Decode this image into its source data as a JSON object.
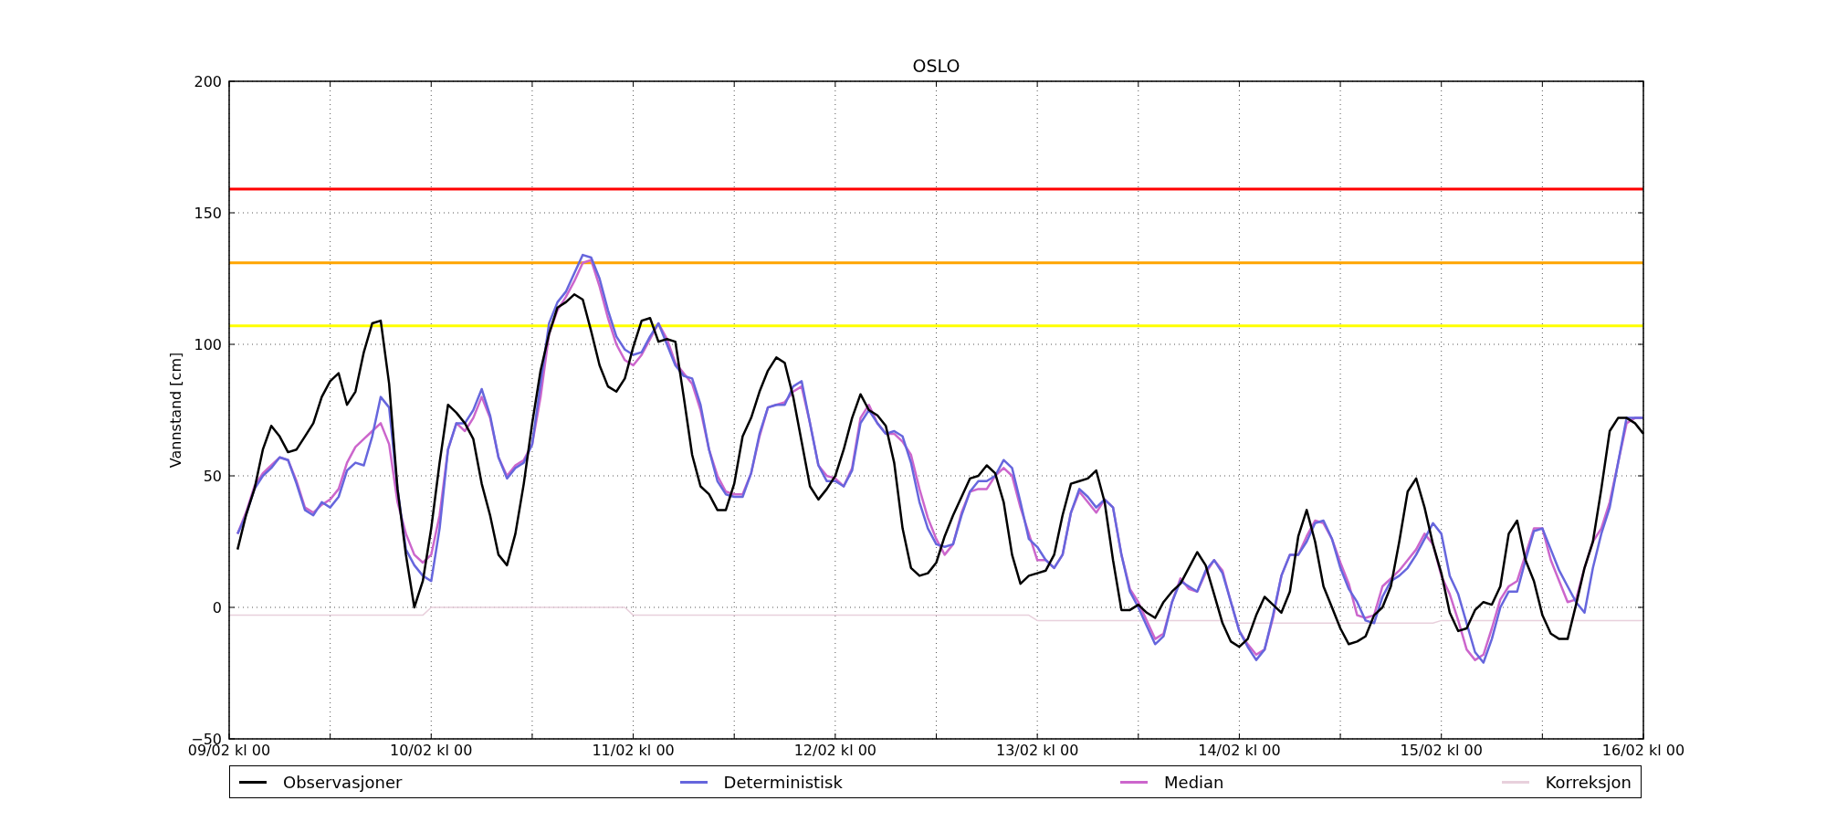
{
  "chart": {
    "chart_data": {
      "type": "line",
      "title": "OSLO",
      "ylabel": "Vannstand [cm]",
      "categories": [
        "09/02 kl 00",
        null,
        null,
        null,
        null,
        null,
        null,
        null,
        null,
        null,
        null,
        null,
        null,
        null,
        null,
        null,
        null,
        null,
        null,
        null,
        null,
        null,
        null,
        null,
        "10/02 kl 00",
        null,
        null,
        null,
        null,
        null,
        null,
        null,
        null,
        null,
        null,
        null,
        null,
        null,
        null,
        null,
        null,
        null,
        null,
        null,
        null,
        null,
        null,
        null,
        "11/02 kl 00",
        null,
        null,
        null,
        null,
        null,
        null,
        null,
        null,
        null,
        null,
        null,
        null,
        null,
        null,
        null,
        null,
        null,
        null,
        null,
        null,
        null,
        null,
        null,
        "12/02 kl 00",
        null,
        null,
        null,
        null,
        null,
        null,
        null,
        null,
        null,
        null,
        null,
        null,
        null,
        null,
        null,
        null,
        null,
        null,
        null,
        null,
        null,
        null,
        null,
        "13/02 kl 00",
        null,
        null,
        null,
        null,
        null,
        null,
        null,
        null,
        null,
        null,
        null,
        null,
        null,
        null,
        null,
        null,
        null,
        null,
        null,
        null,
        null,
        null,
        null,
        "14/02 kl 00",
        null,
        null,
        null,
        null,
        null,
        null,
        null,
        null,
        null,
        null,
        null,
        null,
        null,
        null,
        null,
        null,
        null,
        null,
        null,
        null,
        null,
        null,
        null,
        "15/02 kl 00",
        null,
        null,
        null,
        null,
        null,
        null,
        null,
        null,
        null,
        null,
        null,
        null,
        null,
        null,
        null,
        null,
        null,
        null,
        null,
        null,
        null,
        null,
        null,
        "16/02 kl 00"
      ],
      "series": [
        {
          "name": "Observasjoner",
          "color": "#000000",
          "values": [
            null,
            22,
            35,
            45,
            60,
            69,
            65,
            59,
            60,
            65,
            70,
            80,
            86,
            89,
            77,
            82,
            97,
            108,
            109,
            85,
            45,
            20,
            0,
            10,
            30,
            55,
            77,
            74,
            70,
            64,
            47,
            35,
            20,
            16,
            28,
            47,
            70,
            90,
            104,
            114,
            116,
            119,
            117,
            105,
            92,
            84,
            82,
            87,
            99,
            109,
            110,
            101,
            102,
            101,
            80,
            58,
            46,
            43,
            37,
            37,
            47,
            65,
            72,
            82,
            90,
            95,
            93,
            80,
            63,
            46,
            41,
            45,
            50,
            60,
            72,
            81,
            75,
            73,
            69,
            55,
            30,
            15,
            12,
            13,
            17,
            27,
            35,
            42,
            49,
            50,
            54,
            51,
            40,
            20,
            9,
            12,
            13,
            14,
            20,
            35,
            47,
            48,
            49,
            52,
            40,
            18,
            -1,
            -1,
            1,
            -2,
            -4,
            2,
            6,
            9,
            15,
            21,
            16,
            5,
            -6,
            -13,
            -15,
            -12,
            -3,
            4,
            1,
            -2,
            6,
            27,
            37,
            25,
            8,
            0,
            -8,
            -14,
            -13,
            -11,
            -3,
            0,
            8,
            25,
            44,
            49,
            38,
            24,
            13,
            -2,
            -9,
            -8,
            -1,
            2,
            1,
            8,
            28,
            33,
            18,
            10,
            -3,
            -10,
            -12,
            -12,
            1,
            15,
            25,
            45,
            67,
            72,
            72,
            70,
            66
          ]
        },
        {
          "name": "Deterministisk",
          "color": "#6666dd",
          "values": [
            null,
            28,
            35,
            45,
            50,
            53,
            57,
            56,
            47,
            37,
            35,
            40,
            38,
            42,
            52,
            55,
            54,
            65,
            80,
            76,
            45,
            22,
            16,
            12,
            10,
            30,
            60,
            70,
            70,
            75,
            83,
            73,
            57,
            49,
            53,
            55,
            62,
            85,
            108,
            116,
            120,
            127,
            134,
            133,
            125,
            113,
            103,
            98,
            96,
            97,
            103,
            108,
            100,
            92,
            88,
            87,
            77,
            60,
            48,
            43,
            42,
            42,
            51,
            66,
            76,
            77,
            77,
            84,
            86,
            70,
            54,
            48,
            48,
            46,
            52,
            70,
            75,
            70,
            66,
            67,
            65,
            55,
            40,
            30,
            24,
            23,
            24,
            35,
            44,
            48,
            48,
            50,
            56,
            53,
            40,
            26,
            23,
            18,
            15,
            20,
            36,
            45,
            42,
            38,
            41,
            38,
            20,
            6,
            0,
            -7,
            -14,
            -11,
            2,
            10,
            8,
            6,
            14,
            18,
            13,
            2,
            -9,
            -15,
            -20,
            -16,
            -3,
            12,
            20,
            20,
            25,
            32,
            33,
            26,
            15,
            7,
            2,
            -5,
            -6,
            4,
            10,
            12,
            15,
            20,
            26,
            32,
            28,
            12,
            5,
            -6,
            -17,
            -21,
            -12,
            0,
            6,
            6,
            18,
            29,
            30,
            22,
            14,
            8,
            2,
            -2,
            15,
            28,
            38,
            55,
            72,
            72,
            72
          ]
        },
        {
          "name": "Median",
          "color": "#cc66cc",
          "values": [
            null,
            28,
            36,
            46,
            51,
            54,
            57,
            56,
            48,
            38,
            36,
            39,
            41,
            45,
            55,
            61,
            64,
            67,
            70,
            62,
            40,
            28,
            20,
            17,
            20,
            35,
            60,
            70,
            67,
            72,
            80,
            72,
            57,
            50,
            54,
            56,
            62,
            80,
            104,
            113,
            118,
            124,
            131,
            132,
            122,
            110,
            100,
            94,
            92,
            96,
            102,
            108,
            102,
            93,
            89,
            85,
            75,
            60,
            50,
            44,
            43,
            43,
            51,
            65,
            76,
            77,
            78,
            82,
            84,
            70,
            54,
            50,
            49,
            46,
            53,
            72,
            77,
            70,
            66,
            66,
            63,
            58,
            45,
            34,
            26,
            20,
            24,
            36,
            44,
            45,
            45,
            50,
            53,
            50,
            38,
            28,
            18,
            18,
            15,
            20,
            36,
            44,
            40,
            36,
            41,
            38,
            20,
            7,
            2,
            -5,
            -12,
            -10,
            2,
            11,
            7,
            6,
            13,
            18,
            14,
            2,
            -9,
            -14,
            -18,
            -16,
            -4,
            12,
            20,
            20,
            27,
            33,
            32,
            26,
            17,
            9,
            -3,
            -4,
            -3,
            8,
            11,
            14,
            18,
            22,
            28,
            24,
            12,
            5,
            -5,
            -16,
            -20,
            -18,
            -8,
            3,
            8,
            10,
            20,
            30,
            30,
            18,
            10,
            2,
            3,
            15,
            25,
            30,
            40,
            55,
            70,
            72,
            72
          ]
        },
        {
          "name": "Korreksjon",
          "color": "#e8d0dc",
          "values": [
            -3,
            -3,
            -3,
            -3,
            -3,
            -3,
            -3,
            -3,
            -3,
            -3,
            -3,
            -3,
            -3,
            -3,
            -3,
            -3,
            -3,
            -3,
            -3,
            -3,
            -3,
            -3,
            -3,
            -3,
            0,
            0,
            0,
            0,
            0,
            0,
            0,
            0,
            0,
            0,
            0,
            0,
            0,
            0,
            0,
            0,
            0,
            0,
            0,
            0,
            0,
            0,
            0,
            0,
            -3,
            -3,
            -3,
            -3,
            -3,
            -3,
            -3,
            -3,
            -3,
            -3,
            -3,
            -3,
            -3,
            -3,
            -3,
            -3,
            -3,
            -3,
            -3,
            -3,
            -3,
            -3,
            -3,
            -3,
            -3,
            -3,
            -3,
            -3,
            -3,
            -3,
            -3,
            -3,
            -3,
            -3,
            -3,
            -3,
            -3,
            -3,
            -3,
            -3,
            -3,
            -3,
            -3,
            -3,
            -3,
            -3,
            -3,
            -3,
            -5,
            -5,
            -5,
            -5,
            -5,
            -5,
            -5,
            -5,
            -5,
            -5,
            -5,
            -5,
            -5,
            -5,
            -5,
            -5,
            -5,
            -5,
            -5,
            -5,
            -5,
            -5,
            -5,
            -5,
            -6,
            -6,
            -6,
            -6,
            -6,
            -6,
            -6,
            -6,
            -6,
            -6,
            -6,
            -6,
            -6,
            -6,
            -6,
            -6,
            -6,
            -6,
            -6,
            -6,
            -6,
            -6,
            -6,
            -6,
            -5,
            -5,
            -5,
            -5,
            -5,
            -5,
            -5,
            -5,
            -5,
            -5,
            -5,
            -5,
            -5,
            -5,
            -5,
            -5,
            -5,
            -5,
            -5,
            -5,
            -5,
            -5,
            -5,
            -5,
            -5
          ]
        }
      ],
      "ylim": [
        -50,
        200
      ],
      "yticks": [
        {
          "value": -50,
          "label": "−50"
        },
        0,
        50,
        100,
        150,
        200
      ],
      "grid": true,
      "ref_lines": [
        {
          "axis": "y",
          "value": 159,
          "color": "#ff0000"
        },
        {
          "axis": "y",
          "value": 131,
          "color": "#ffa500"
        },
        {
          "axis": "y",
          "value": 107,
          "color": "#ffff00"
        }
      ]
    }
  }
}
